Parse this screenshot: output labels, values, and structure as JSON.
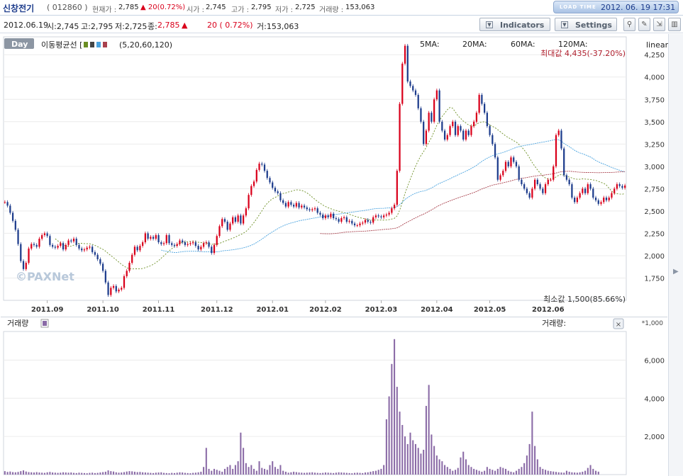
{
  "header": {
    "name": "신창전기",
    "code": "( 012860 )",
    "quotes": [
      {
        "label": "현재가 :",
        "value": "2,785"
      },
      {
        "label": "",
        "value": "▲ 20(0.72%)",
        "color": "red"
      },
      {
        "label": "시가 :",
        "value": "2,745"
      },
      {
        "label": "고가 :",
        "value": "2,795"
      },
      {
        "label": "저가 :",
        "value": "2,725"
      },
      {
        "label": "거래량 :",
        "value": "153,063"
      }
    ],
    "loadtime_label": "LOAD TIME",
    "loadtime": "2012. 06. 19 17:31"
  },
  "info": {
    "date": "2012.06.19",
    "open": "시:2,745",
    "high": "고:2,795",
    "low": "저:2,725",
    "close_label": "종:",
    "close": "2,785",
    "up_icon": "▲",
    "change": "20 (  0.72%)",
    "volume": "거:153,063"
  },
  "toolbar": {
    "indicators": "Indicators",
    "settings": "Settings",
    "icons": [
      "pin-icon",
      "pencil-icon",
      "fit-icon",
      "layout-icon"
    ]
  },
  "colors": {
    "up": "#d9001b",
    "down": "#1d3c8c",
    "ma5": "#444444",
    "ma20": "#6b8e23",
    "ma60": "#4aa3df",
    "ma120": "#a9424e",
    "volume": "#8a6aa6",
    "grid": "#ececec"
  },
  "chart_data": [
    {
      "type": "candlestick",
      "title": "",
      "period_label": "Day",
      "ma_label": "이동평균선 [",
      "ma_periods": "(5,20,60,120)",
      "ma_legend": [
        "5MA:",
        "20MA:",
        "60MA:",
        "120MA:"
      ],
      "scale_label": "linear",
      "max_label": "최대값 4,435(-37.20%)",
      "min_label": "최소값 1,500(85.66%)",
      "watermark": "©PAXNet",
      "ylim": [
        1500,
        4450
      ],
      "yticks": [
        1750,
        2000,
        2250,
        2500,
        2750,
        3000,
        3250,
        3500,
        3750,
        4000,
        4250
      ],
      "ytick_labels": [
        "1,750",
        "2,000",
        "2,250",
        "2,500",
        "2,750",
        "3,000",
        "3,250",
        "3,500",
        "3,750",
        "4,000",
        "4,250"
      ],
      "months": [
        "2011.09",
        "2011.10",
        "2011.11",
        "2011.12",
        "2012.01",
        "2012.02",
        "2012.03",
        "2012.04",
        "2012.05",
        "2012.06"
      ],
      "closes": [
        2600,
        2560,
        2480,
        2390,
        2290,
        2130,
        1940,
        1850,
        1920,
        2080,
        2130,
        2120,
        2100,
        2190,
        2230,
        2250,
        2220,
        2120,
        2100,
        2090,
        2110,
        2140,
        2070,
        2120,
        2170,
        2160,
        2190,
        2120,
        2080,
        2060,
        2070,
        2090,
        2100,
        2040,
        2010,
        1960,
        1910,
        1830,
        1700,
        1560,
        1640,
        1660,
        1600,
        1620,
        1640,
        1770,
        1830,
        1920,
        2010,
        2100,
        2060,
        2110,
        2150,
        2250,
        2190,
        2210,
        2190,
        2230,
        2150,
        2130,
        2140,
        2230,
        2140,
        2120,
        2110,
        2130,
        2170,
        2150,
        2120,
        2130,
        2140,
        2150,
        2110,
        2070,
        2100,
        2140,
        2150,
        2100,
        2030,
        2120,
        2220,
        2330,
        2410,
        2380,
        2290,
        2360,
        2430,
        2380,
        2450,
        2360,
        2450,
        2530,
        2680,
        2780,
        2830,
        2960,
        3030,
        3020,
        2950,
        2870,
        2820,
        2760,
        2720,
        2700,
        2620,
        2590,
        2550,
        2600,
        2570,
        2550,
        2590,
        2540,
        2560,
        2540,
        2520,
        2510,
        2520,
        2530,
        2480,
        2460,
        2420,
        2450,
        2430,
        2470,
        2420,
        2410,
        2380,
        2420,
        2430,
        2380,
        2390,
        2360,
        2340,
        2340,
        2360,
        2370,
        2400,
        2380,
        2370,
        2430,
        2450,
        2440,
        2430,
        2450,
        2460,
        2480,
        2530,
        2570,
        2950,
        3700,
        4150,
        4350,
        3950,
        3900,
        3850,
        3800,
        3650,
        3500,
        3250,
        3400,
        3600,
        3500,
        3750,
        3850,
        3500,
        3400,
        3300,
        3350,
        3450,
        3500,
        3350,
        3450,
        3400,
        3300,
        3400,
        3350,
        3450,
        3500,
        3600,
        3800,
        3700,
        3600,
        3450,
        3350,
        3250,
        3100,
        2850,
        2900,
        2950,
        3050,
        3000,
        3100,
        3050,
        3000,
        2850,
        2800,
        2750,
        2700,
        2650,
        2750,
        2850,
        2800,
        2750,
        2700,
        2800,
        2850,
        2850,
        3000,
        3350,
        3400,
        3200,
        2900,
        2850,
        2800,
        2650,
        2600,
        2650,
        2700,
        2750,
        2700,
        2800,
        2750,
        2650,
        2620,
        2580,
        2600,
        2650,
        2620,
        2650,
        2700,
        2750,
        2800,
        2780,
        2760,
        2785
      ],
      "volume": {
        "label": "거래량",
        "legend": "거래량:",
        "multiplier_label": "*1,000",
        "ylim": [
          0,
          7500
        ],
        "yticks": [
          2000,
          4000,
          6000
        ],
        "ytick_labels": [
          "2,000",
          "4,000",
          "6,000"
        ],
        "values": [
          180,
          140,
          160,
          130,
          120,
          140,
          180,
          220,
          160,
          130,
          120,
          110,
          130,
          110,
          100,
          90,
          120,
          140,
          110,
          100,
          90,
          100,
          120,
          110,
          100,
          110,
          90,
          80,
          100,
          90,
          80,
          70,
          90,
          100,
          80,
          90,
          110,
          130,
          150,
          220,
          180,
          160,
          120,
          100,
          110,
          130,
          160,
          180,
          170,
          150,
          130,
          140,
          120,
          110,
          100,
          90,
          80,
          100,
          110,
          120,
          90,
          80,
          70,
          90,
          80,
          100,
          120,
          110,
          90,
          80,
          70,
          90,
          100,
          120,
          150,
          400,
          1400,
          300,
          200,
          300,
          250,
          200,
          150,
          300,
          400,
          500,
          300,
          500,
          700,
          2200,
          1400,
          600,
          400,
          500,
          300,
          200,
          700,
          350,
          300,
          250,
          500,
          700,
          400,
          300,
          500,
          200,
          150,
          100,
          120,
          150,
          130,
          110,
          100,
          90,
          100,
          110,
          120,
          100,
          90,
          80,
          90,
          110,
          100,
          90,
          80,
          100,
          120,
          110,
          100,
          90,
          80,
          70,
          90,
          100,
          90,
          80,
          110,
          120,
          150,
          180,
          200,
          250,
          300,
          500,
          2900,
          4100,
          5800,
          7100,
          4600,
          3300,
          2600,
          2000,
          1600,
          2200,
          1800,
          1600,
          1400,
          1100,
          1300,
          3600,
          4700,
          2100,
          1500,
          1000,
          800,
          700,
          500,
          400,
          300,
          200,
          250,
          350,
          900,
          1200,
          800,
          500,
          400,
          300,
          250,
          200,
          150,
          200,
          400,
          300,
          250,
          200,
          300,
          400,
          350,
          300,
          200,
          150,
          120,
          200,
          300,
          400,
          600,
          1000,
          1600,
          3300,
          1500,
          800,
          400,
          300,
          250,
          200,
          180,
          160,
          140,
          120,
          110,
          100,
          200,
          150,
          120,
          110,
          100,
          120,
          150,
          200,
          350,
          500,
          300,
          200,
          153
        ]
      }
    }
  ]
}
